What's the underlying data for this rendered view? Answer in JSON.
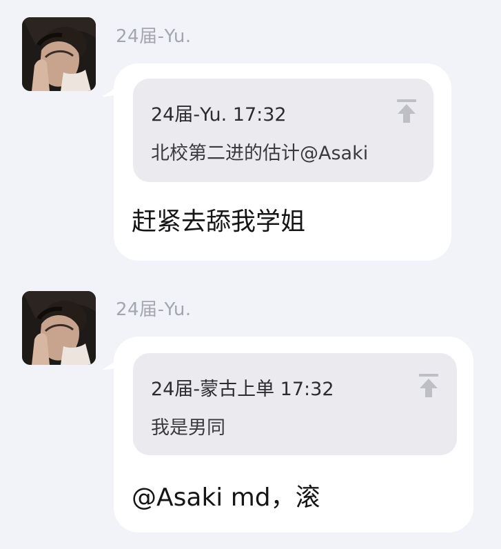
{
  "messages": [
    {
      "sender": "24届-Yu.",
      "avatar_icon": "user-avatar-photo",
      "quote": {
        "meta": "24届-Yu. 17:32",
        "text": "北校第二进的估计@Asaki",
        "jump_icon": "jump-to-message-icon"
      },
      "text": "赶紧去舔我学姐"
    },
    {
      "sender": "24届-Yu.",
      "avatar_icon": "user-avatar-photo",
      "quote": {
        "meta": "24届-蒙古上单 17:32",
        "text": "我是男同",
        "jump_icon": "jump-to-message-icon"
      },
      "text": "@Asaki md，滚"
    }
  ],
  "colors": {
    "background": "#f2f3f8",
    "bubble": "#ffffff",
    "quote_background": "#ebebef",
    "sender_text": "#a3a6ad",
    "icon": "#bdbfc4"
  }
}
